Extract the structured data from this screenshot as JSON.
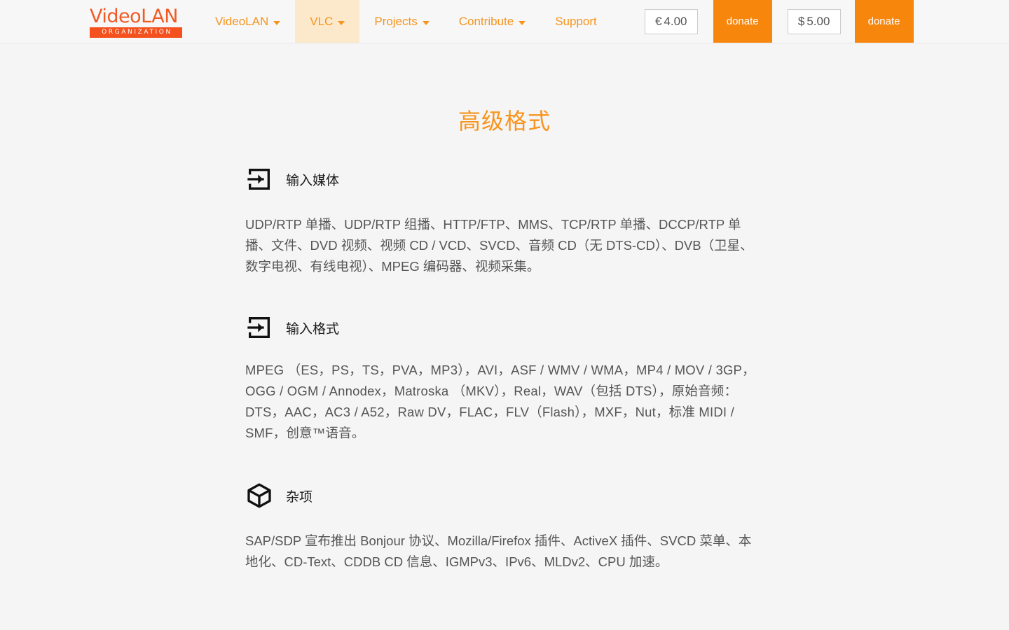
{
  "nav": {
    "logo": {
      "word": "VideoLAN",
      "sub": "ORGANIZATION"
    },
    "items": [
      {
        "label": "VideoLAN",
        "caret": true,
        "active": false
      },
      {
        "label": "VLC",
        "caret": true,
        "active": true
      },
      {
        "label": "Projects",
        "caret": true,
        "active": false
      },
      {
        "label": "Contribute",
        "caret": true,
        "active": false
      },
      {
        "label": "Support",
        "caret": false,
        "active": false
      }
    ],
    "donate": {
      "eur_symbol": "€",
      "eur_amount": "4.00",
      "usd_symbol": "$",
      "usd_amount": "5.00",
      "button_label_1": "donate",
      "button_label_2": "donate"
    }
  },
  "page": {
    "title": "高级格式"
  },
  "sections": [
    {
      "icon": "log-in-icon",
      "title": "输入媒体",
      "body": "UDP/RTP 单播、UDP/RTP 组播、HTTP/FTP、MMS、TCP/RTP 单播、DCCP/RTP 单播、文件、DVD 视频、视频 CD / VCD、SVCD、音频 CD（无 DTS-CD）、DVB（卫星、数字电视、有线电视）、MPEG 编码器、视频采集。"
    },
    {
      "icon": "log-in-icon",
      "title": "输入格式",
      "body": "MPEG （ES，PS，TS，PVA，MP3），AVI，ASF / WMV / WMA，MP4 / MOV / 3GP，OGG / OGM / Annodex，Matroska （MKV），Real，WAV（包括 DTS），原始音频：DTS，AAC，AC3 / A52，Raw DV，FLAC，FLV（Flash），MXF，Nut，标准 MIDI / SMF，创意™语音。"
    },
    {
      "icon": "box-icon",
      "title": "杂项",
      "body": "SAP/SDP 宣布推出 Bonjour 协议、Mozilla/Firefox 插件、ActiveX 插件、SVCD 菜单、本地化、CD-Text、CDDB CD 信息、IGMPv3、IPv6、MLDv2、CPU 加速。"
    }
  ],
  "colors": {
    "brand_orange": "#f7941e",
    "logo_orange": "#f15a24",
    "donate_orange": "#f7860d",
    "active_tab_bg": "#fce9cb",
    "page_bg": "#f5f5f5",
    "body_text": "#555555"
  }
}
